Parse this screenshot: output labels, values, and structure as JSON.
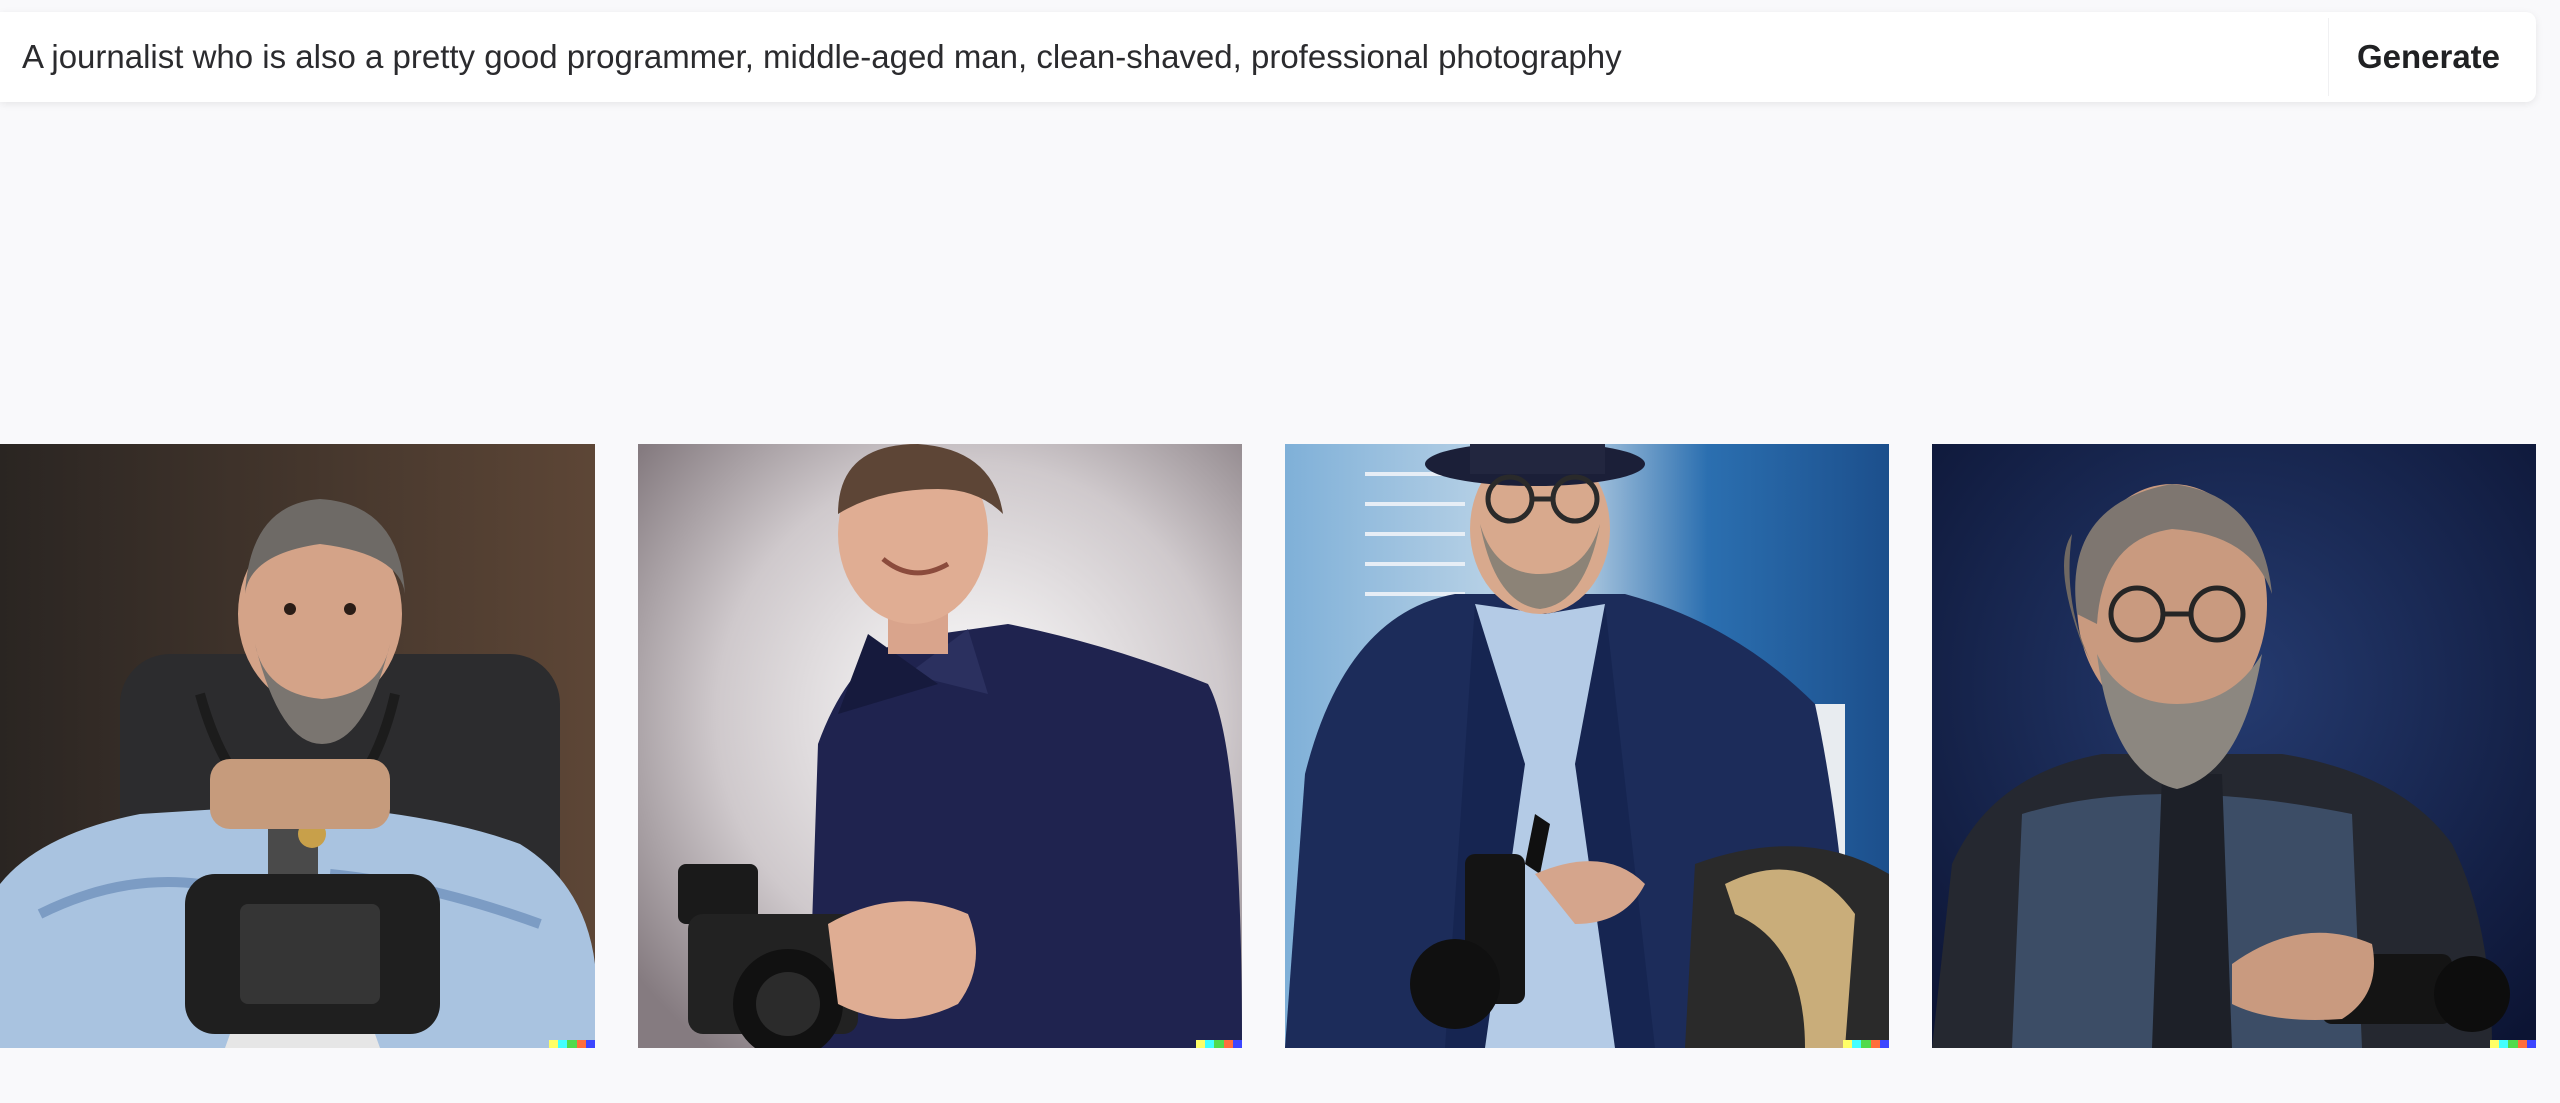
{
  "prompt": {
    "value": "A journalist who is also a pretty good programmer, middle-aged man, clean-shaved, professional photography",
    "generate_label": "Generate"
  },
  "images": [
    {
      "name": "generated-image-1",
      "subject": "bearded man in patterned shirt seated in office chair holding a camera rig"
    },
    {
      "name": "generated-image-2",
      "subject": "clean-shaved man in navy shirt smiling at a DSLR camera"
    },
    {
      "name": "generated-image-3",
      "subject": "man with glasses and hat in blue blazer holding camera near window"
    },
    {
      "name": "generated-image-4",
      "subject": "bearded man with glasses in dark sweater holding a camera"
    }
  ],
  "colors": {
    "background": "#f9f9fb",
    "bar": "#ffffff",
    "text": "#2b2b2e",
    "watermark": [
      "#ffff66",
      "#42ffff",
      "#51da4c",
      "#ff6e3c",
      "#3c46ff"
    ]
  }
}
